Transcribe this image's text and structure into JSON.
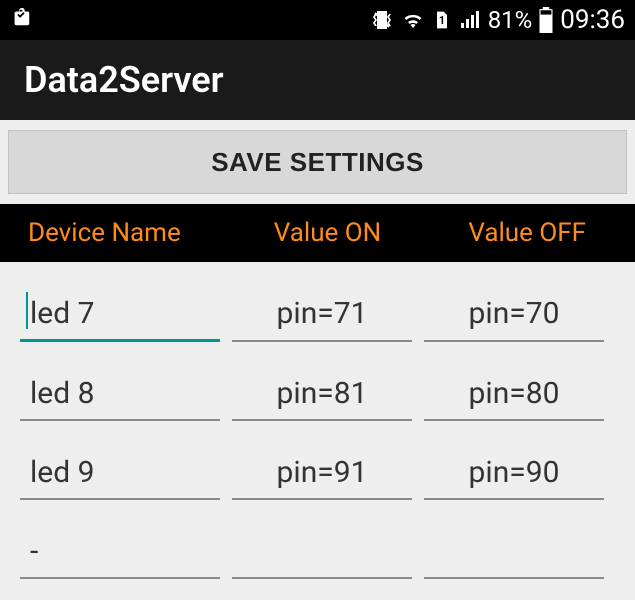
{
  "status_bar": {
    "battery_text": "81%",
    "time": "09:36"
  },
  "app": {
    "title": "Data2Server"
  },
  "button": {
    "save_label": "SAVE SETTINGS"
  },
  "headers": {
    "name": "Device Name",
    "on": "Value ON",
    "off": "Value OFF"
  },
  "rows": [
    {
      "name": "led 7",
      "on": "pin=71",
      "off": "pin=70",
      "focused": true
    },
    {
      "name": "led 8",
      "on": "pin=81",
      "off": "pin=80",
      "focused": false
    },
    {
      "name": "led 9",
      "on": "pin=91",
      "off": "pin=90",
      "focused": false
    },
    {
      "name": "-",
      "on": "",
      "off": "",
      "focused": false
    }
  ]
}
